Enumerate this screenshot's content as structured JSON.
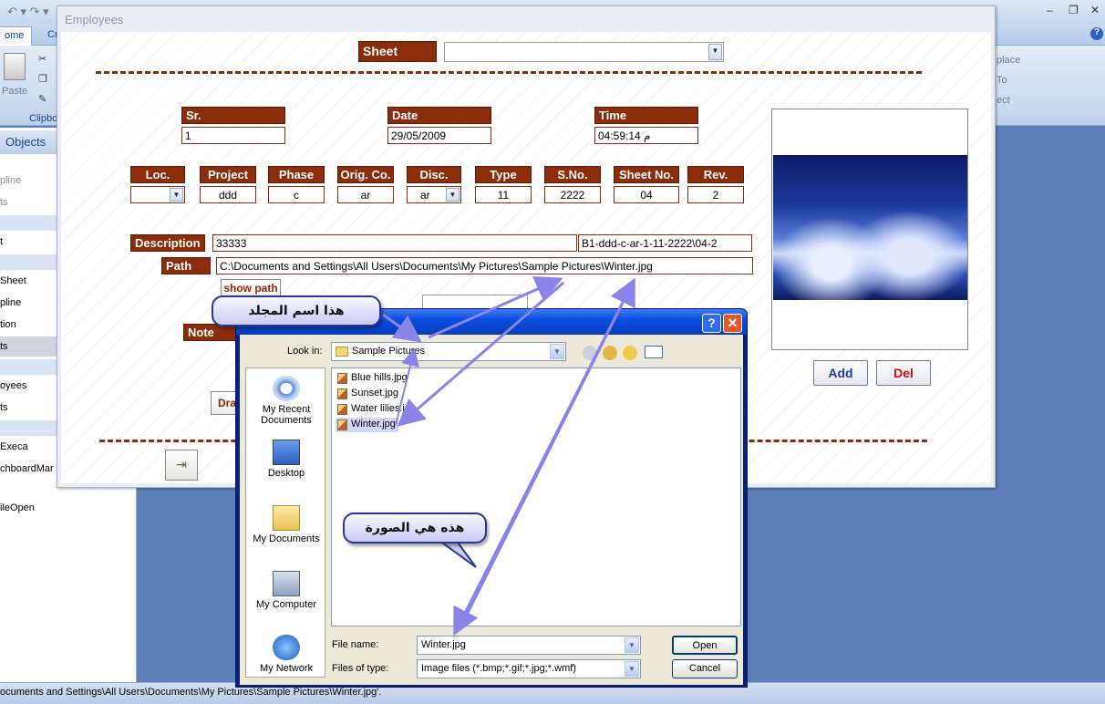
{
  "app": {
    "ribbon_tabs": [
      "ome",
      "Cr"
    ],
    "paste_label": "Paste",
    "clipboard_group": "Clipbo",
    "right_ribbon": [
      "place",
      "To",
      "ect"
    ],
    "window_controls": [
      "–",
      "❐",
      "✕"
    ]
  },
  "nav": {
    "header": "Objects",
    "items": [
      "pline",
      "ts",
      "t",
      "Sheet",
      "pline",
      "tion",
      "ts",
      "oyees",
      "ts",
      "Execa",
      "chboardMar",
      "ileOpen"
    ]
  },
  "status_bar": {
    "text": "ocuments and Settings\\All Users\\Documents\\My Pictures\\Sample Pictures\\Winter.jpg'."
  },
  "form": {
    "title": "Employees",
    "sheet_label": "Sheet",
    "sheet_value": "",
    "sr_label": "Sr.",
    "sr_value": "1",
    "date_label": "Date",
    "date_value": "29/05/2009",
    "time_label": "Time",
    "time_value": "م 04:59:14",
    "loc_label": "Loc.",
    "loc_value": "",
    "project_label": "Project",
    "project_value": "ddd",
    "phase_label": "Phase",
    "phase_value": "c",
    "orig_label": "Orig. Co.",
    "orig_value": "ar",
    "disc_label": "Disc.",
    "disc_value": "ar",
    "type_label": "Type",
    "type_value": "11",
    "sno_label": "S.No.",
    "sno_value": "2222",
    "sheetno_label": "Sheet No.",
    "sheetno_value": "04",
    "rev_label": "Rev.",
    "rev_value": "2",
    "description_label": "Description",
    "description_value": "33333",
    "code_value": "B1-ddd-c-ar-1-11-2222\\04-2",
    "path_label": "Path",
    "path_value": "C:\\Documents and Settings\\All Users\\Documents\\My Pictures\\Sample Pictures\\Winter.jpg",
    "show_path_label": "show path",
    "note_label": "Note",
    "draft_label": "Draf",
    "add_label": "Add",
    "del_label": "Del"
  },
  "callouts": {
    "folder": "هذا اسم المجلد",
    "image": "هذه هي الصورة"
  },
  "dialog": {
    "look_in_label": "Look in:",
    "look_in_value": "Sample Pictures",
    "places": [
      "My Recent Documents",
      "Desktop",
      "My Documents",
      "My Computer",
      "My Network"
    ],
    "files": [
      "Blue hills.jpg",
      "Sunset.jpg",
      "Water lilies.jpg",
      "Winter.jpg"
    ],
    "selected_file": "Winter.jpg",
    "file_name_label": "File name:",
    "file_name_value": "Winter.jpg",
    "file_type_label": "Files of type:",
    "file_type_value": "Image files (*.bmp;*.gif;*.jpg;*.wmf)",
    "open_label": "Open",
    "cancel_label": "Cancel",
    "help_label": "?",
    "close_label": "✕"
  },
  "colors": {
    "label_bg": "#8b2d0b",
    "dialog_title": "#0a4ee0",
    "callout_border": "#2b3596",
    "arrow": "#8a84e8"
  }
}
